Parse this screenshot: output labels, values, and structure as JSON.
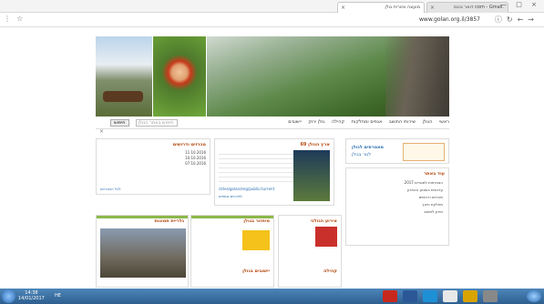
{
  "browser": {
    "tabs": [
      {
        "label": "מועצה אזורית גולן",
        "active": true
      },
      {
        "label": ".com - Gmail דואר נכנס",
        "active": false
      },
      {
        "label": "",
        "active": false
      }
    ],
    "url": "www.golan.org.il/3857"
  },
  "site": {
    "nav": [
      "ראשי",
      "הגולן",
      "שירותי התושב",
      "אגפים ומחלקות",
      "קהילה",
      "גולן ירוק",
      "יישובים"
    ],
    "search_button": "חיפוש",
    "search_placeholder": "חיפוש באתר הגולן"
  },
  "boxes": {
    "banner_ad": {
      "title": "מצטרפים לגולן",
      "subtitle": "לגור בגולן"
    },
    "updates_title": "עוד באתר",
    "updates_items": [
      "הצטרפות למגורים 2017",
      "עדכונים בשבוע האחרון",
      "מכרזים ודרושים",
      "מחלקת חינוך",
      "מידע לתושב"
    ],
    "news_title": "ארץ הגולן 69",
    "news_link": "/sites/golan/eng/public/current",
    "news_more": "לפרטים נוספים",
    "tenders_title": "מכרזים ודרושים",
    "tenders_more": "לכל המכרזים",
    "tenders_items": [
      "11.10.2016",
      "10.10.2016",
      "07.10.2016"
    ],
    "event_title": "אירוע הגולני",
    "recycle_title": "מיחזור בגולן",
    "gallery_title": "גלריית תמונות",
    "bottom1": "קהילה",
    "bottom2": "יישובים בגולן"
  },
  "taskbar": {
    "time": "14:38",
    "date": "14/01/2017",
    "lang": "HE"
  },
  "colors": {
    "accent": "#b54a10",
    "green": "#8bb84a",
    "taskbar": "#2e5f8f"
  }
}
